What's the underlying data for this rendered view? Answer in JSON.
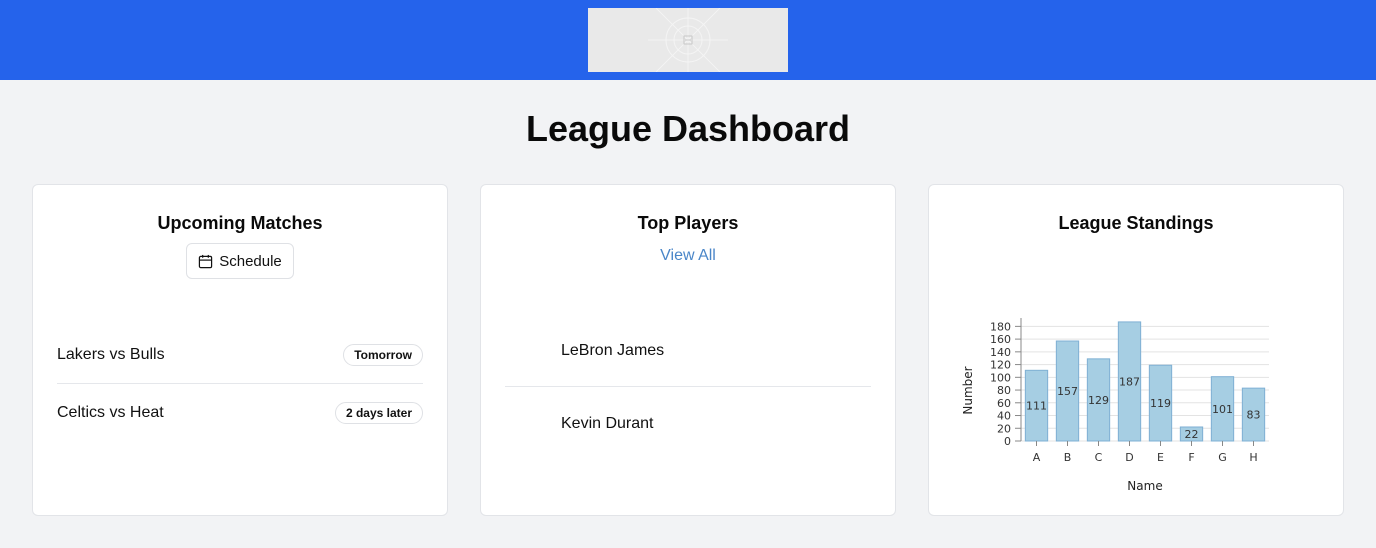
{
  "header": {
    "logo_icon": "image-placeholder-icon"
  },
  "page_title": "League Dashboard",
  "upcoming": {
    "title": "Upcoming Matches",
    "schedule_label": "Schedule",
    "schedule_icon": "calendar-icon",
    "matches": [
      {
        "name": "Lakers vs Bulls",
        "when": "Tomorrow"
      },
      {
        "name": "Celtics vs Heat",
        "when": "2 days later"
      }
    ]
  },
  "players": {
    "title": "Top Players",
    "view_all": "View All",
    "items": [
      {
        "name": "LeBron James"
      },
      {
        "name": "Kevin Durant"
      }
    ]
  },
  "standings": {
    "title": "League Standings"
  },
  "chart_data": {
    "type": "bar",
    "categories": [
      "A",
      "B",
      "C",
      "D",
      "E",
      "F",
      "G",
      "H"
    ],
    "values": [
      111,
      157,
      129,
      187,
      119,
      22,
      101,
      83
    ],
    "xlabel": "Name",
    "ylabel": "Number",
    "ylim": [
      0,
      190
    ],
    "yticks": [
      0,
      20,
      40,
      60,
      80,
      100,
      120,
      140,
      160,
      180
    ],
    "grid": true,
    "bar_color": "#a6cee3",
    "bar_stroke": "#7fb0d4"
  }
}
